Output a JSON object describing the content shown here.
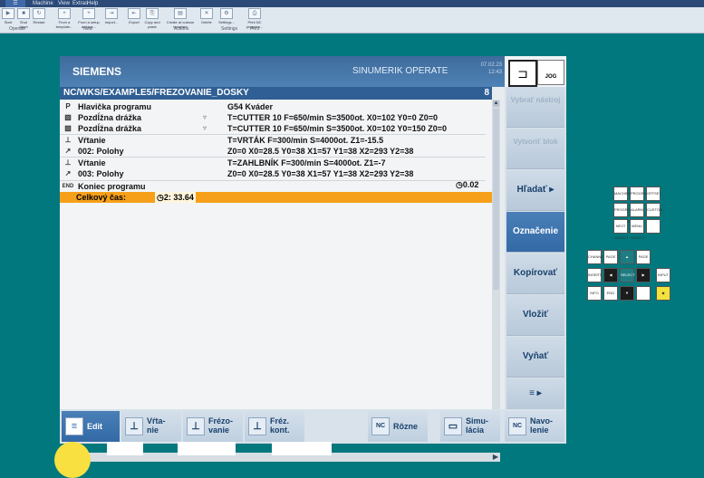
{
  "ribbon": {
    "menu_label": "☰",
    "tabs": [
      "Machine",
      "View",
      "Extras",
      "Help"
    ],
    "buttons": [
      "Start",
      "Shut down",
      "Restart",
      "From a template...",
      "From a setup archive...",
      "Import...",
      "Export",
      "Copy and paste",
      "Create at custom template",
      "Delete",
      "Settings...",
      "Print NC program..."
    ],
    "groups": [
      "Operate",
      "New",
      "Actions",
      "Settings",
      "Print"
    ]
  },
  "hmi": {
    "brand": "SIEMENS",
    "product": "SINUMERIK OPERATE",
    "date": "07.02.23",
    "time": "12:43",
    "mode_label": "JOG",
    "path": "NC/WKS/EXAMPLE5/FREZOVANIE_DOSKY",
    "channel_num": "8",
    "program_rows": [
      {
        "icon": "P",
        "name": "Hlavička programu",
        "arrow": "",
        "params": "G54 Kváder"
      },
      {
        "icon": "▧",
        "name": "Pozdĺžna drážka",
        "arrow": "▿",
        "params": "T=CUTTER 10 F=650/min S=3500ot. X0=102 Y0=0 Z0=0"
      },
      {
        "icon": "▧",
        "name": "Pozdĺžna drážka",
        "arrow": "▿",
        "params": "T=CUTTER 10 F=650/min S=3500ot. X0=102 Y0=150 Z0=0"
      },
      {
        "icon": "⊥",
        "name": "Vŕtanie",
        "arrow": "",
        "params": "T=VRTÁK F=300/min S=4000ot. Z1=-15.5"
      },
      {
        "icon": "↗",
        "name": "002: Polohy",
        "arrow": "",
        "params": "Z0=0 X0=28.5 Y0=38 X1=57 Y1=38 X2=293 Y2=38"
      },
      {
        "icon": "⊥",
        "name": "Vŕtanie",
        "arrow": "",
        "params": "T=ZAHLBNÍK F=300/min S=4000ot. Z1=-7"
      },
      {
        "icon": "↗",
        "name": "003: Polohy",
        "arrow": "",
        "params": "Z0=0 X0=28.5 Y0=38 X1=57 Y1=38 X2=293 Y2=38"
      },
      {
        "icon": "END",
        "name": "Koniec programu",
        "arrow": "",
        "params": ""
      }
    ],
    "end_time": "◷0.02",
    "total_label": "Celkový čas:",
    "total_value": "◷2: 33.64"
  },
  "softkeys": [
    {
      "label": "Vybrať nástroj",
      "state": "disabled"
    },
    {
      "label": "Vytvoriť blok",
      "state": "disabled"
    },
    {
      "label": "Hľadať ▸",
      "state": "normal"
    },
    {
      "label": "Označenie",
      "state": "active"
    },
    {
      "label": "Kopírovať",
      "state": "normal"
    },
    {
      "label": "Vložiť",
      "state": "normal"
    },
    {
      "label": "Vyňať",
      "state": "normal"
    },
    {
      "label": "≡ ▸",
      "state": "normal"
    }
  ],
  "horizontal_keys": [
    {
      "label": "Edit",
      "icon": "≡",
      "state": "active"
    },
    {
      "label": "Vŕta- nie",
      "icon": "⊥",
      "state": "normal"
    },
    {
      "label": "Frézo- vanie",
      "icon": "⊥",
      "state": "normal"
    },
    {
      "label": "Fréz. kont.",
      "icon": "⊥",
      "state": "normal"
    },
    {
      "label": "Rôzne",
      "icon": "NC",
      "state": "normal"
    },
    {
      "label": "Simu- lácia",
      "icon": "▭",
      "state": "normal"
    },
    {
      "label": "Navo- lenie",
      "icon": "NC",
      "state": "normal"
    }
  ],
  "keypad": {
    "labels": [
      "MACHINE",
      "PROGRAM",
      "OFFSET",
      "PROGRAM MANAGER",
      "ALARM",
      "CUSTOM",
      "NEXT SELECT",
      "MENU SELECT",
      "CHANNEL",
      "SELECT",
      "▲",
      "◀",
      "▶",
      "▼",
      "INSERT",
      "INPUT",
      "END",
      "PAGE UP",
      "PAGE DOWN",
      "INFO"
    ]
  },
  "colors": {
    "accent": "#336aa6",
    "background": "#00787e",
    "highlight": "#f6a01a"
  }
}
